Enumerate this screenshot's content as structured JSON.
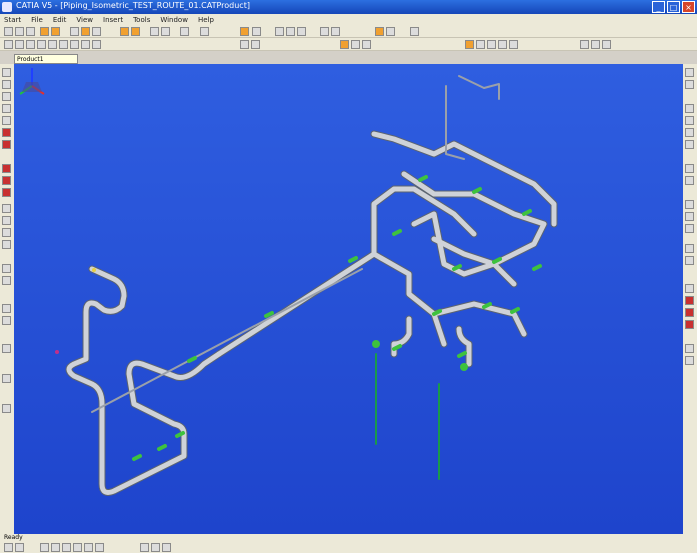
{
  "window": {
    "title": "CATIA V5 - [Piping_Isometric_TEST_ROUTE_01.CATProduct]"
  },
  "menu": {
    "items": [
      "Start",
      "File",
      "Edit",
      "View",
      "Insert",
      "Tools",
      "Window",
      "Help"
    ]
  },
  "tree": {
    "root_label": "Product1"
  },
  "status": {
    "text": "Ready"
  },
  "colors": {
    "viewport": "#2f5ee0",
    "pipe": "#cfd2d8",
    "flange": "#3ec23e",
    "support": "#1a9a4a"
  }
}
